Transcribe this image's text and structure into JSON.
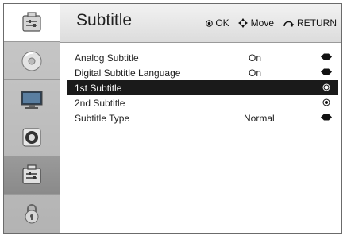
{
  "header": {
    "title": "Subtitle",
    "hint_ok": "OK",
    "hint_move": "Move",
    "hint_return": "RETURN"
  },
  "sidebar": {
    "items": [
      {
        "icon": "tv-settings-icon"
      },
      {
        "icon": "disc-icon"
      },
      {
        "icon": "monitor-icon"
      },
      {
        "icon": "speaker-icon"
      },
      {
        "icon": "settings-panel-icon"
      },
      {
        "icon": "lock-icon"
      }
    ]
  },
  "rows": [
    {
      "label": "Analog Subtitle",
      "value": "On",
      "control": "toggle"
    },
    {
      "label": "Digital Subtitle Language",
      "value": "On",
      "control": "toggle"
    },
    {
      "label": "1st Subtitle",
      "value": "",
      "control": "radio"
    },
    {
      "label": "2nd Subtitle",
      "value": "",
      "control": "radio"
    },
    {
      "label": "Subtitle Type",
      "value": "Normal",
      "control": "toggle"
    }
  ],
  "selected_row": "1st Subtitle"
}
